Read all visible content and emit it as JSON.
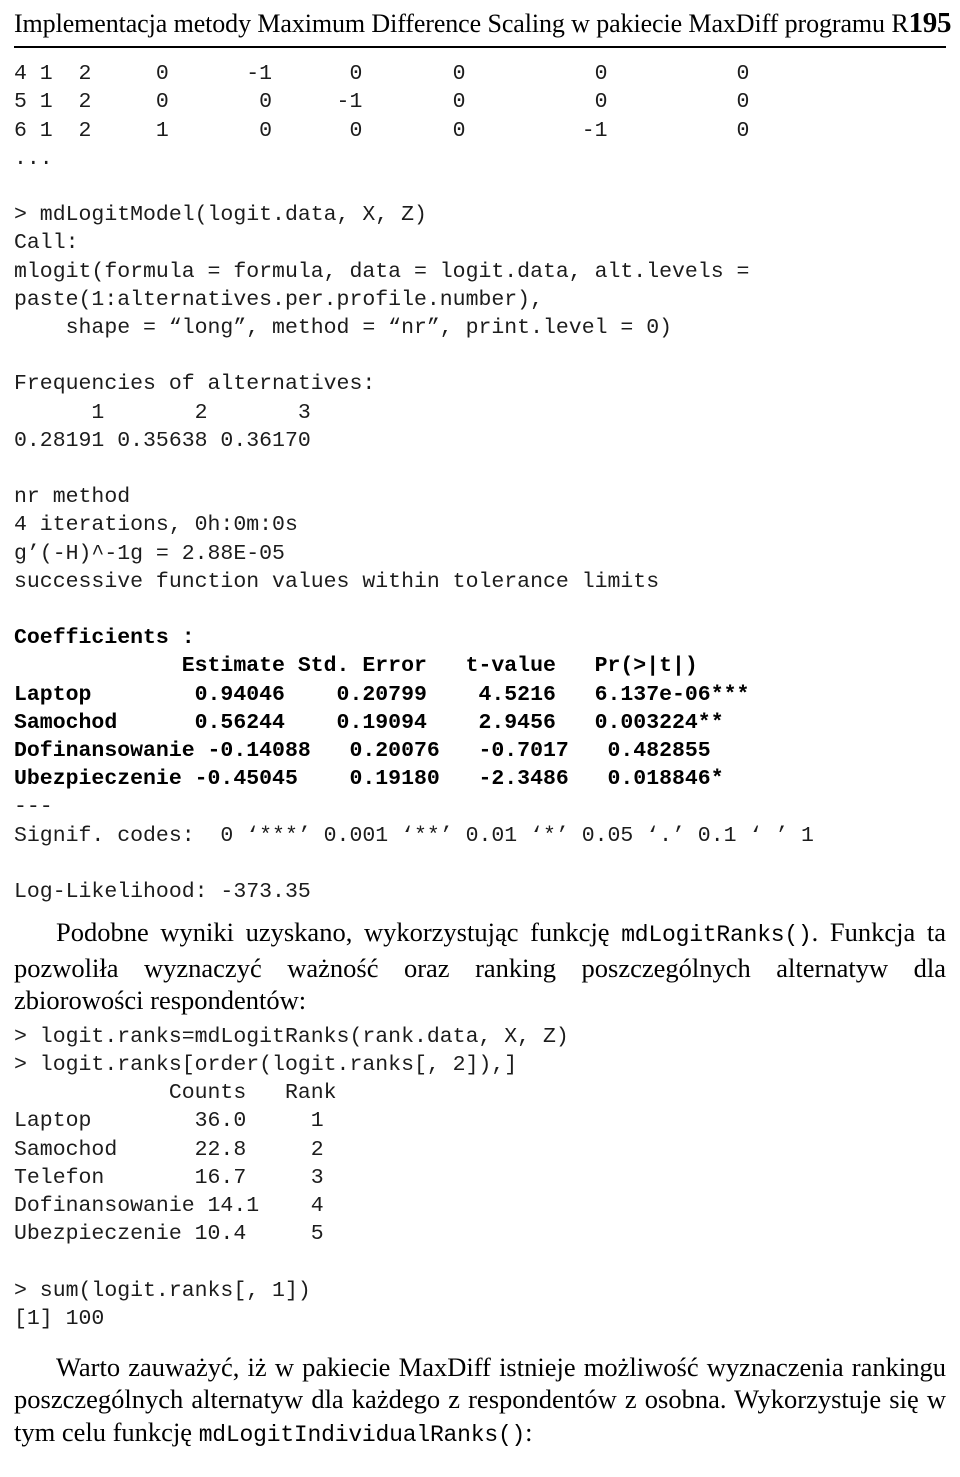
{
  "header": {
    "title": "Implementacja metody Maximum Difference Scaling w pakiecie MaxDiff programu R",
    "page_number": "195"
  },
  "matrix": {
    "rows": [
      "4 1  2     0      -1      0       0          0          0",
      "5 1  2     0       0     -1       0          0          0",
      "6 1  2     1       0      0       0         -1          0"
    ],
    "ellipsis": "..."
  },
  "model_call": {
    "prompt_line": "> mdLogitModel(logit.data, X, Z)",
    "call_label": "Call:",
    "call_lines": [
      "mlogit(formula = formula, data = logit.data, alt.levels =",
      "paste(1:alternatives.per.profile.number),",
      "    shape = “long”, method = “nr”, print.level = 0)"
    ]
  },
  "frequencies": {
    "label": "Frequencies of alternatives:",
    "header": "      1       2       3",
    "values": "0.28191 0.35638 0.36170"
  },
  "optimization": {
    "method": "nr method",
    "iterations": "4 iterations, 0h:0m:0s",
    "gradient": "g’(-H)^-1g = 2.88E-05",
    "convergence": "successive function values within tolerance limits"
  },
  "coefficients": {
    "label": "Coefficients :",
    "columns": [
      "Estimate",
      "Std. Error",
      "t-value",
      "Pr(>|t|)"
    ],
    "header_line": "             Estimate Std. Error   t-value   Pr(>|t|)",
    "rows": [
      {
        "term": "Laptop",
        "estimate": "0.94046",
        "std_error": "0.20799",
        "t_value": "4.5216",
        "p_value": "6.137e-06***",
        "line": "Laptop        0.94046    0.20799    4.5216   6.137e-06***"
      },
      {
        "term": "Samochod",
        "estimate": "0.56244",
        "std_error": "0.19094",
        "t_value": "2.9456",
        "p_value": "0.003224**",
        "line": "Samochod      0.56244    0.19094    2.9456   0.003224**"
      },
      {
        "term": "Dofinansowanie",
        "estimate": "-0.14088",
        "std_error": "0.20076",
        "t_value": "-0.7017",
        "p_value": "0.482855",
        "line": "Dofinansowanie -0.14088   0.20076   -0.7017   0.482855"
      },
      {
        "term": "Ubezpieczenie",
        "estimate": "-0.45045",
        "std_error": "0.19180",
        "t_value": "-2.3486",
        "p_value": "0.018846*",
        "line": "Ubezpieczenie -0.45045    0.19180   -2.3486   0.018846*"
      }
    ],
    "rule": "---",
    "signif_codes": "Signif. codes:  0 ‘***’ 0.001 ‘**’ 0.01 ‘*’ 0.05 ‘.’ 0.1 ‘ ’ 1",
    "log_likelihood": "Log-Likelihood: -373.35"
  },
  "paragraph_1": {
    "text_before_code": "Podobne wyniki uzyskano, wykorzystując funkcję ",
    "inline_code": "mdLogitRanks()",
    "text_after_code": ". Funkcja ta pozwoliła wyznaczyć ważność oraz ranking poszczególnych alternatyw dla zbiorowości respondentów:"
  },
  "ranks_session": {
    "prompt_lines": [
      "> logit.ranks=mdLogitRanks(rank.data, X, Z)",
      "> logit.ranks[order(logit.ranks[, 2]),]"
    ],
    "table_header": "            Counts   Rank",
    "columns": [
      "Counts",
      "Rank"
    ],
    "rows": [
      {
        "term": "Laptop",
        "counts": "36.0",
        "rank": "1",
        "line": "Laptop        36.0     1"
      },
      {
        "term": "Samochod",
        "counts": "22.8",
        "rank": "2",
        "line": "Samochod      22.8     2"
      },
      {
        "term": "Telefon",
        "counts": "16.7",
        "rank": "3",
        "line": "Telefon       16.7     3"
      },
      {
        "term": "Dofinansowanie",
        "counts": "14.1",
        "rank": "4",
        "line": "Dofinansowanie 14.1    4"
      },
      {
        "term": "Ubezpieczenie",
        "counts": "10.4",
        "rank": "5",
        "line": "Ubezpieczenie 10.4     5"
      }
    ]
  },
  "sum_session": {
    "prompt_line": "> sum(logit.ranks[, 1])",
    "output_line": "[1] 100"
  },
  "paragraph_2": {
    "text_before_code": "Warto zauważyć, iż w pakiecie MaxDiff istnieje możliwość wyznaczenia rankingu poszczególnych alternatyw dla każdego z respondentów z osobna. Wykorzystuje się w tym celu funkcję ",
    "inline_code": "mdLogitIndividualRanks()",
    "text_after_code": ":"
  }
}
